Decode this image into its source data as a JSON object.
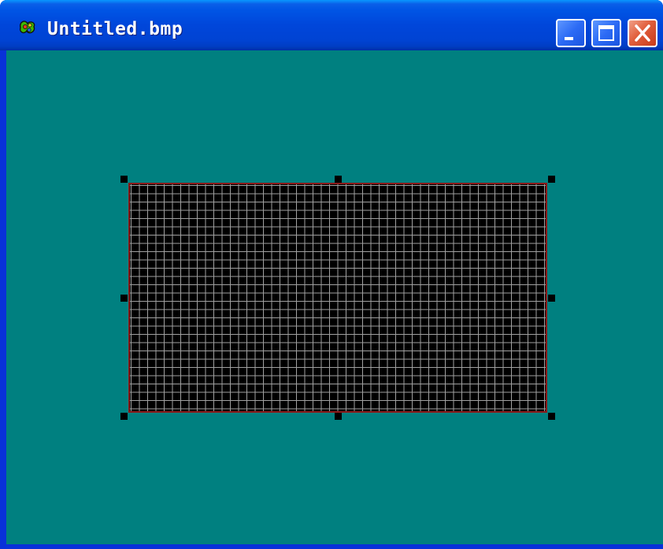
{
  "window": {
    "title": "Untitled.bmp",
    "app_icon": "paint-app-icon",
    "controls": {
      "minimize": "minimize-icon",
      "maximize": "maximize-icon",
      "close": "close-icon"
    }
  },
  "colors": {
    "titlebar": "#0055e5",
    "client_background": "#008080",
    "canvas_background": "#000000",
    "grid_lines": "#a0a0a0",
    "canvas_border": "#8b1a1a",
    "selection_handles": "#000000"
  },
  "canvas": {
    "grid_visible": true,
    "selection_handles": 8
  }
}
